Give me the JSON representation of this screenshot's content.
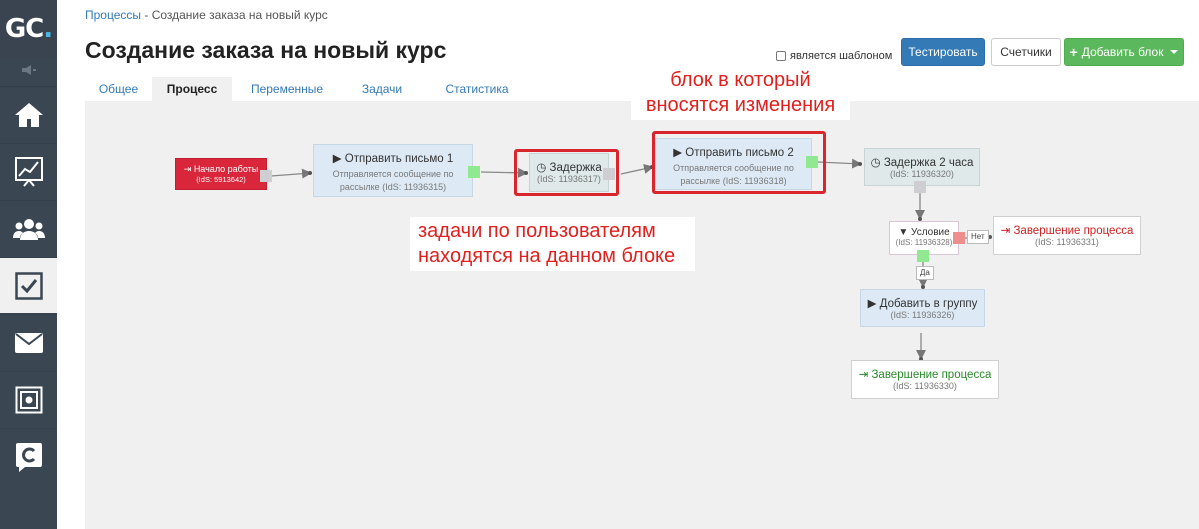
{
  "logo": {
    "text": "GC",
    "dot": "."
  },
  "breadcrumb": {
    "link": "Процессы",
    "separator": " - ",
    "current": "Создание заказа на новый курс"
  },
  "page_title": "Создание заказа на новый курс",
  "header": {
    "template_checkbox_label": "является шаблоном",
    "test_button": "Тестировать",
    "counters_button": "Счетчики",
    "add_block_button": "Добавить блок"
  },
  "tabs": [
    {
      "label": "Общее",
      "active": false
    },
    {
      "label": "Процесс",
      "active": true
    },
    {
      "label": "Переменные",
      "active": false
    },
    {
      "label": "Задачи",
      "active": false
    },
    {
      "label": "Статистика",
      "active": false
    }
  ],
  "sidebar": {
    "items": [
      {
        "icon": "home-icon"
      },
      {
        "icon": "chart-icon"
      },
      {
        "icon": "users-icon"
      },
      {
        "icon": "tasks-icon",
        "active": true
      },
      {
        "icon": "mail-icon"
      },
      {
        "icon": "safe-icon"
      },
      {
        "icon": "chat-logo-icon"
      }
    ]
  },
  "blocks": {
    "start": {
      "title": "Начало работы",
      "id": "(IdS: 5913642)"
    },
    "send1": {
      "title": "Отправить письмо 1",
      "sub": "Отправляется сообщение по рассылке",
      "id": "(IdS: 11936315)"
    },
    "delay1": {
      "title": "Задержка",
      "id": "(IdS: 11936317)"
    },
    "send2": {
      "title": "Отправить письмо 2",
      "sub": "Отправляется сообщение по рассылке",
      "id": "(IdS: 11936318)"
    },
    "delay2": {
      "title": "Задержка 2 часа",
      "id": "(IdS: 11936320)"
    },
    "cond": {
      "title": "Условие",
      "id": "(IdS: 11936328)"
    },
    "end_red": {
      "title": "Завершение процесса",
      "id": "(IdS: 11936331)"
    },
    "add_group": {
      "title": "Добавить в группу",
      "id": "(IdS: 11936326)"
    },
    "end_green": {
      "title": "Завершение процесса",
      "id": "(IdS: 11936330)"
    }
  },
  "edge_labels": {
    "no": "Нет",
    "yes": "Да"
  },
  "annotations": {
    "changes_line1": "блок в который",
    "changes_line2": "вносятся изменения",
    "tasks_line1": "задачи по пользователям",
    "tasks_line2": "находятся на данном блоке"
  },
  "colors": {
    "sidebar": "#3a4652",
    "accent": "#337ab7",
    "add": "#5cb85c",
    "start": "#d9263a",
    "highlight": "#d9262c"
  }
}
